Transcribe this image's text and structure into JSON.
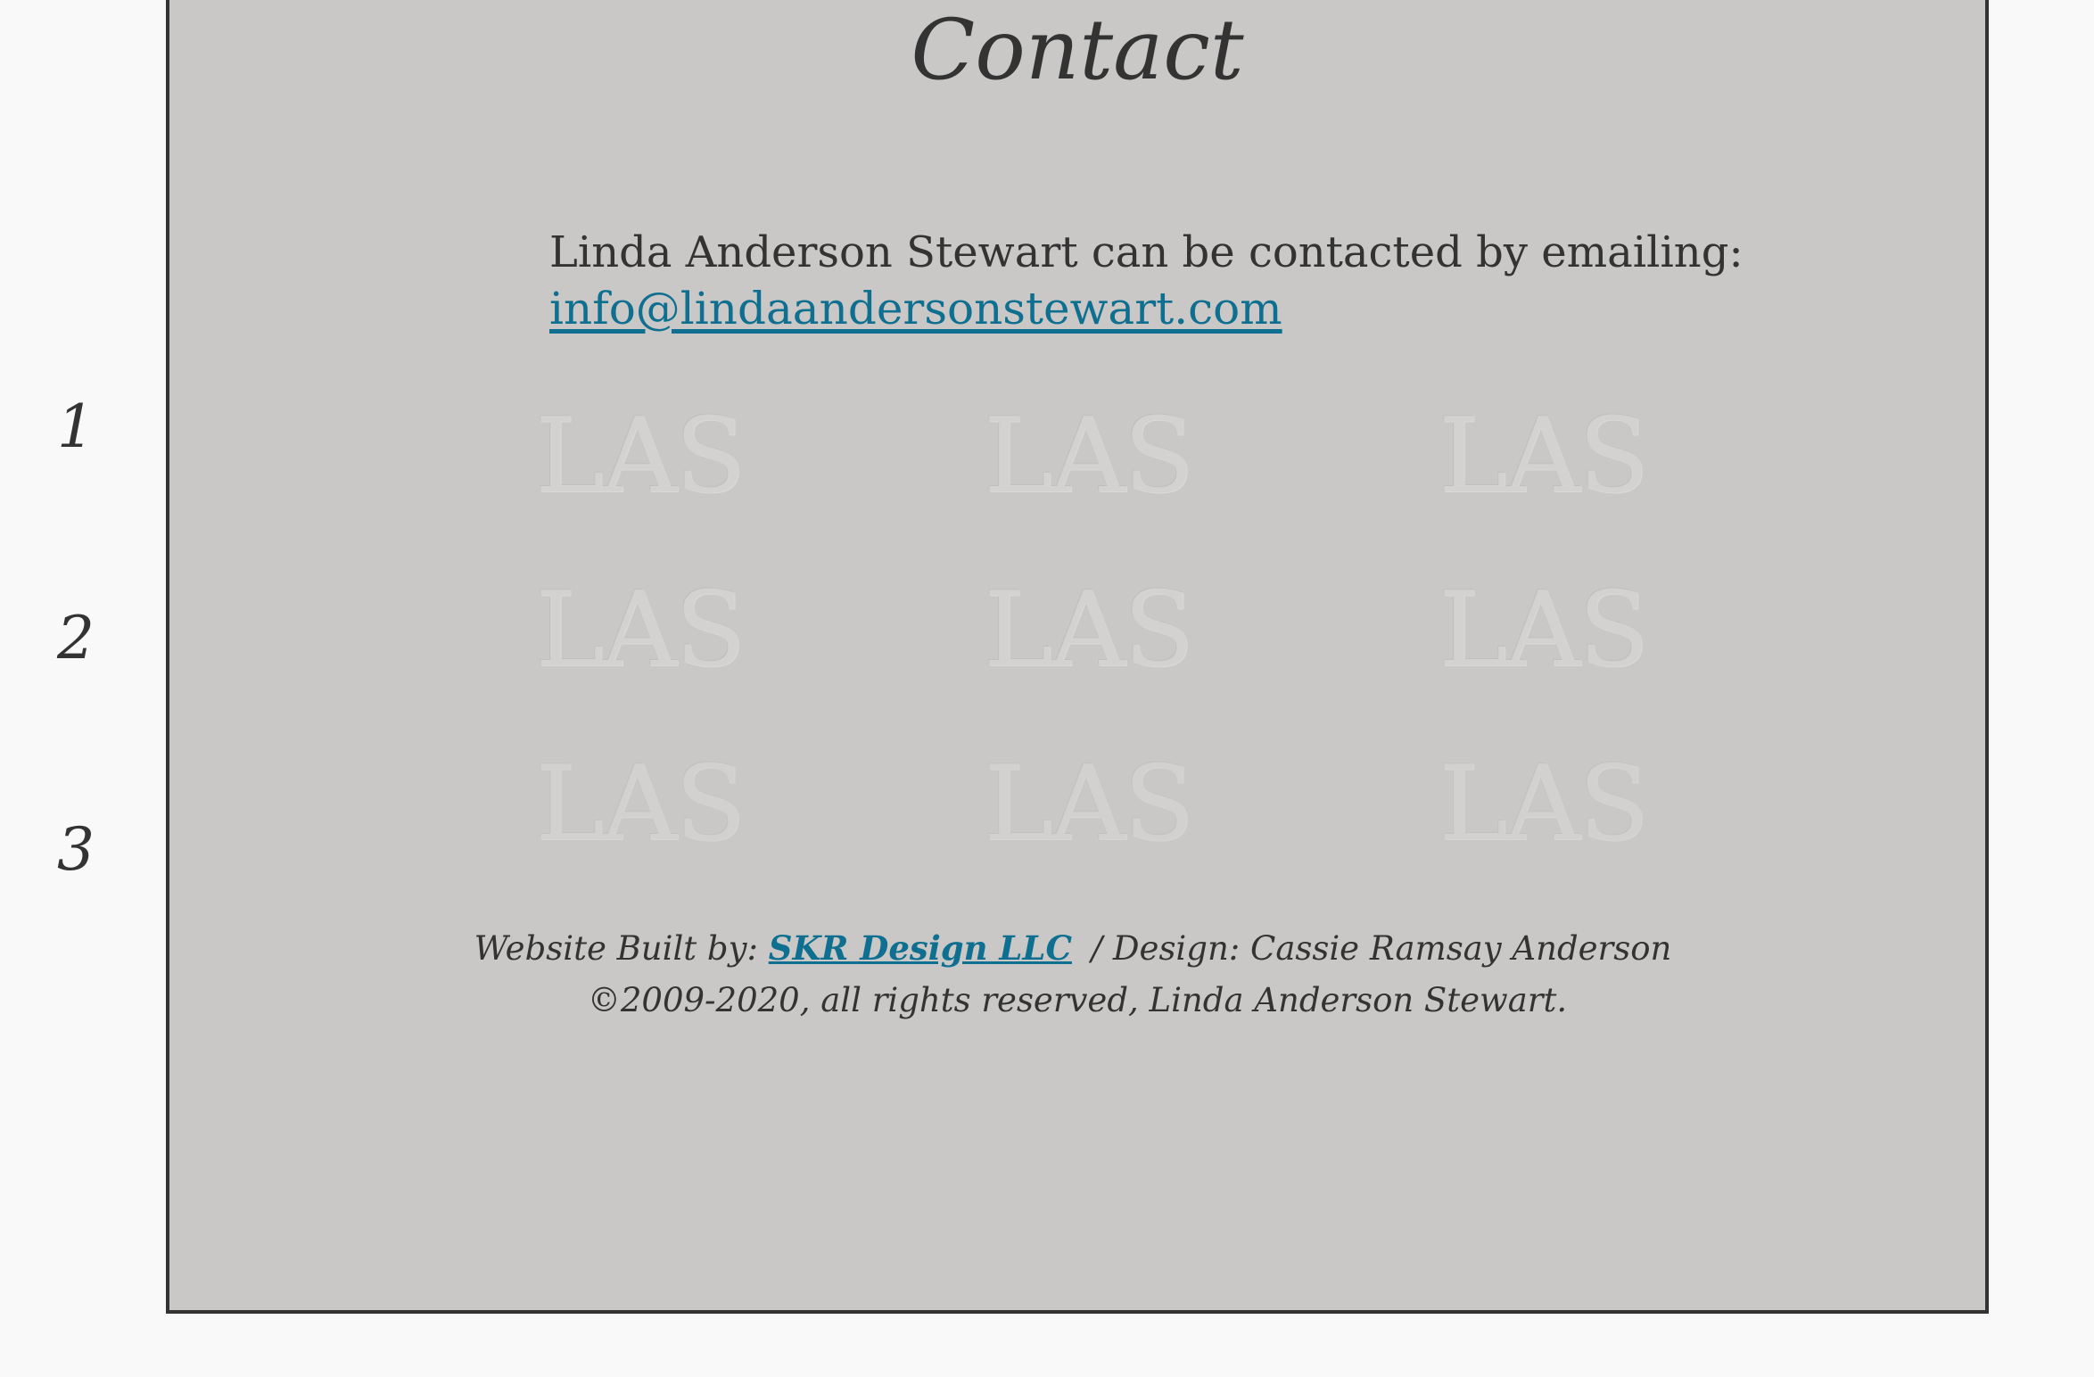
{
  "side_nav": {
    "items": [
      {
        "label": "1"
      },
      {
        "label": "2"
      },
      {
        "label": "3"
      }
    ]
  },
  "main": {
    "title": "Contact",
    "contact_text": "Linda Anderson Stewart can be contacted by emailing:",
    "email": "info@lindaandersonstewart.com",
    "watermark_text": "LAS"
  },
  "footer": {
    "built_by_label": "Website Built by:",
    "built_by_link": "SKR Design LLC",
    "design_credit": "/ Design: Cassie Ramsay Anderson",
    "copyright": "©2009-2020, all rights reserved, Linda Anderson Stewart."
  },
  "colors": {
    "panel_background": "#c9c8c6",
    "page_background": "#f9f9f9",
    "text": "#333333",
    "link": "#0e6f90",
    "border": "#333333"
  }
}
